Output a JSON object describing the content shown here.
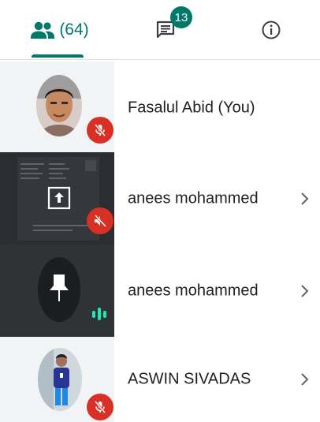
{
  "tabs": {
    "people_count": "(64)",
    "chat_badge": "13",
    "people_icon": "people-icon",
    "chat_icon": "chat-icon",
    "info_icon": "info-icon"
  },
  "participants": [
    {
      "name": "Fasalul Abid (You)",
      "muted": true,
      "tile": "photo"
    },
    {
      "name": "anees mohammed",
      "muted": true,
      "tile": "screen-share",
      "chevron": true
    },
    {
      "name": "anees mohammed",
      "muted": false,
      "tile": "pin",
      "chevron": true
    },
    {
      "name": "ASWIN SIVADAS",
      "muted": true,
      "tile": "photo",
      "chevron": true
    }
  ],
  "colors": {
    "accent": "#00796b",
    "mute_red": "#d93025",
    "audio_green": "#1de9b6"
  }
}
